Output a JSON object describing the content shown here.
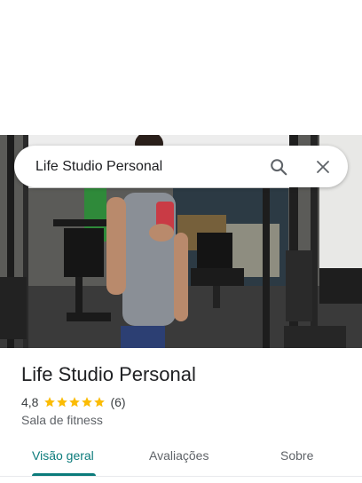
{
  "search": {
    "query": "Life Studio Personal",
    "search_icon": "search-icon",
    "close_icon": "close-icon"
  },
  "place": {
    "name": "Life Studio Personal",
    "rating": "4,8",
    "stars": 5,
    "review_count": "(6)",
    "category": "Sala de fitness"
  },
  "tabs": [
    {
      "label": "Visão geral",
      "active": true
    },
    {
      "label": "Avaliações",
      "active": false
    },
    {
      "label": "Sobre",
      "active": false
    }
  ],
  "colors": {
    "accent": "#0b7b7b",
    "star": "#fbbc04",
    "title_text": "#202124",
    "secondary_text": "#5f6368"
  }
}
